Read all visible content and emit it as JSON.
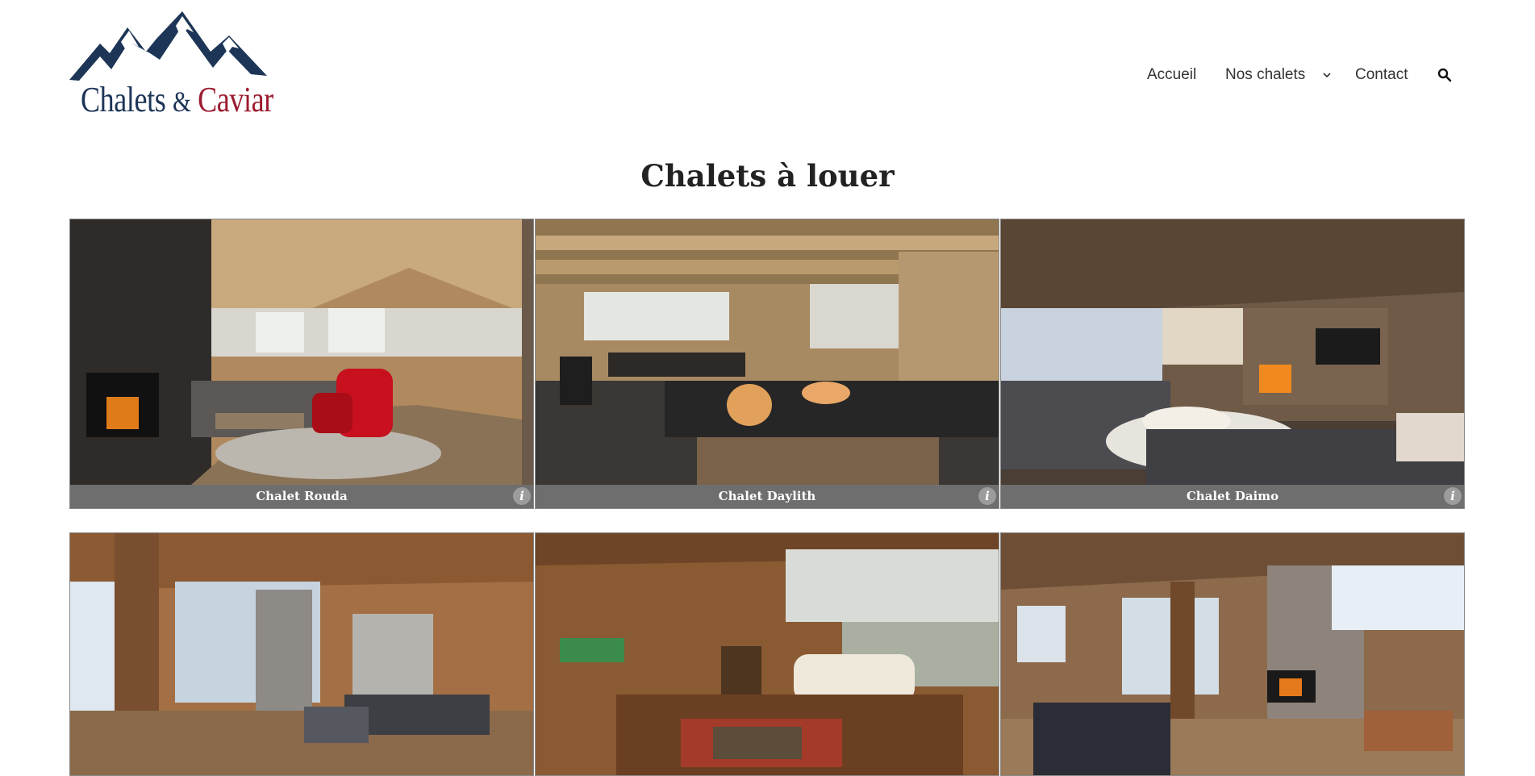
{
  "brand": {
    "word1": "Chalets",
    "amp": "&",
    "word2": "Caviar"
  },
  "nav": {
    "items": [
      "Accueil",
      "Nos chalets",
      "Contact"
    ],
    "dropdown_icon": "chevron-down-icon",
    "search_icon": "search-icon"
  },
  "page": {
    "title": "Chalets à louer"
  },
  "chalets": [
    {
      "name": "Chalet Rouda",
      "info": "i"
    },
    {
      "name": "Chalet Daylith",
      "info": "i"
    },
    {
      "name": "Chalet Daimo",
      "info": "i"
    },
    {
      "name": "",
      "info": ""
    },
    {
      "name": "",
      "info": ""
    },
    {
      "name": "",
      "info": ""
    }
  ],
  "colors": {
    "navy": "#1d3557",
    "burgundy": "#9b1b30",
    "caption_bg": "#6e6e6e"
  }
}
